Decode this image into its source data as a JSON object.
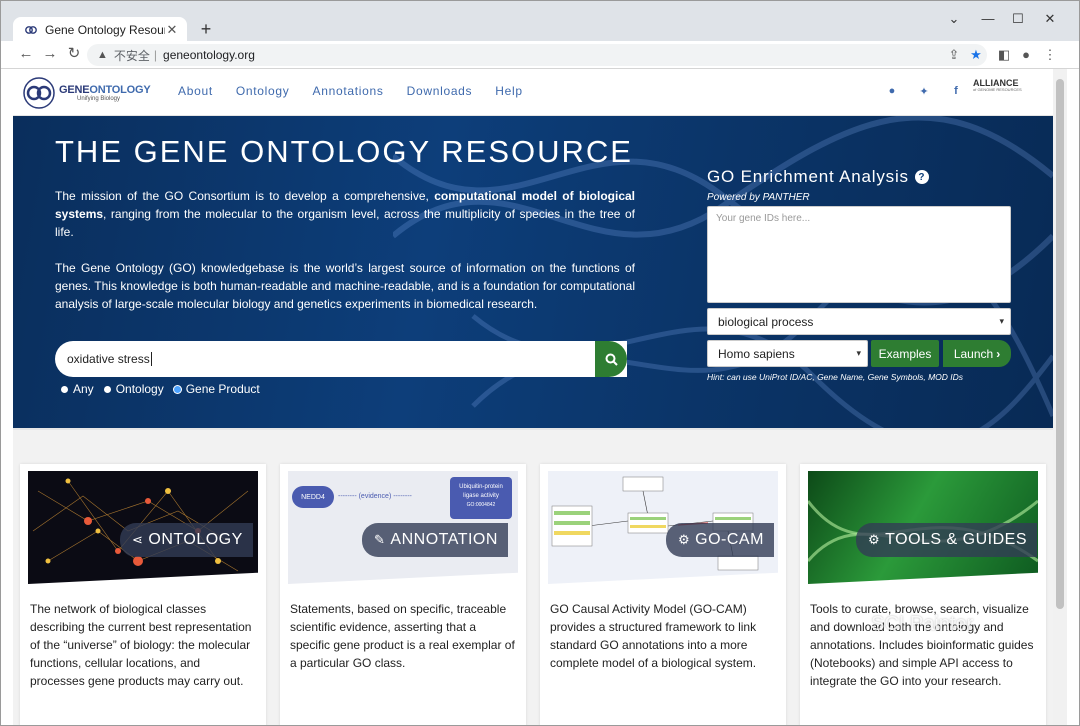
{
  "browser": {
    "tab_title": "Gene Ontology Resource",
    "tab_close": "✕",
    "new_tab": "+",
    "win_min": "—",
    "win_max": "☐",
    "win_close": "✕",
    "back": "←",
    "forward": "→",
    "reload": "↻",
    "insecure_label": "不安全",
    "separator": "|",
    "url": "geneontology.org"
  },
  "site": {
    "logo_gene": "GENE",
    "logo_ontology": "ONTOLOGY",
    "logo_tagline": "Unifying Biology",
    "nav": [
      "About",
      "Ontology",
      "Annotations",
      "Downloads",
      "Help"
    ],
    "alliance": "ALLIANCE",
    "alliance_sub": "of GENOME RESOURCES"
  },
  "hero": {
    "title": "THE GENE ONTOLOGY RESOURCE",
    "p1_a": "The mission of the GO Consortium is to develop a comprehensive, ",
    "p1_b": "computational model of biological systems",
    "p1_c": ", ranging from the molecular to the organism level, across the multiplicity of species in the tree of life.",
    "p2": "The Gene Ontology (GO) knowledgebase is the world’s largest source of information on the functions of genes. This knowledge is both human-readable and machine-readable, and is a foundation for computational analysis of large-scale molecular biology and genetics experiments in biomedical research.",
    "search_value": "oxidative stress",
    "radios": [
      {
        "label": "Any",
        "selected": false
      },
      {
        "label": "Ontology",
        "selected": false
      },
      {
        "label": "Gene Product",
        "selected": true
      }
    ]
  },
  "enrichment": {
    "title": "GO Enrichment Analysis",
    "help": "?",
    "powered": "Powered by PANTHER",
    "placeholder": "Your gene IDs here...",
    "process": "biological process",
    "organism": "Homo sapiens",
    "examples": "Examples",
    "launch": "Launch",
    "hint": "Hint: can use UniProt ID/AC, Gene Name, Gene Symbols, MOD IDs"
  },
  "cards": [
    {
      "title": "ONTOLOGY",
      "icon": "share-icon",
      "desc": "The network of biological classes describing the current best representation of the “universe” of biology: the molecular functions, cellular locations, and processes gene products may carry out."
    },
    {
      "title": "ANNOTATION",
      "icon": "edit-icon",
      "desc": "Statements, based on specific, traceable scientific evidence, asserting that a specific gene product is a real exemplar of a particular GO class.",
      "diagram": {
        "node": "NEDD4",
        "edge": "-------- (evidence) --------",
        "box1": "Ubiquitin-protein",
        "box2": "ligase activity",
        "box3": "GO:0004842"
      }
    },
    {
      "title": "GO-CAM",
      "icon": "gear-icon",
      "desc": "GO Causal Activity Model (GO-CAM) provides a structured framework to link standard GO annotations into a more complete model of a biological system."
    },
    {
      "title": "TOOLS & GUIDES",
      "icon": "gear-icon",
      "desc": "Tools to curate, browse, search, visualize and download both the ontology and annotations. Includes bioinformatic guides (Notebooks) and simple API access to integrate the GO into your research."
    }
  ],
  "watermark": "SCI Painter",
  "colors": {
    "accent": "#3f6aad",
    "hero_bg": "#0d3e7a",
    "green": "#2e7d32"
  }
}
